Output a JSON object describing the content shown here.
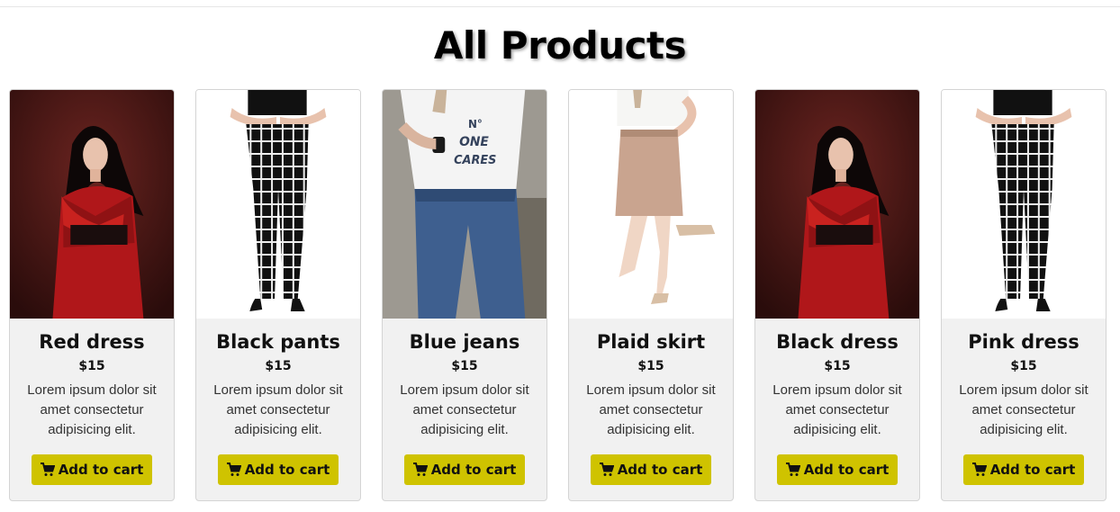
{
  "page": {
    "title": "All Products"
  },
  "theme": {
    "button_color": "#cfc300",
    "card_bg": "#f1f1f1"
  },
  "products": [
    {
      "title": "Red dress",
      "price": "$15",
      "description": "Lorem ipsum dolor sit amet consectetur adipisicing elit.",
      "button": "Add to cart",
      "image": "woman-red-coat",
      "icon": "cart-icon"
    },
    {
      "title": "Black pants",
      "price": "$15",
      "description": "Lorem ipsum dolor sit amet consectetur adipisicing elit.",
      "button": "Add to cart",
      "image": "plaid-black-pants",
      "icon": "cart-icon"
    },
    {
      "title": "Blue jeans",
      "price": "$15",
      "description": "Lorem ipsum dolor sit amet consectetur adipisicing elit.",
      "button": "Add to cart",
      "image": "woman-blue-jeans",
      "icon": "cart-icon"
    },
    {
      "title": "Plaid skirt",
      "price": "$15",
      "description": "Lorem ipsum dolor sit amet consectetur adipisicing elit.",
      "button": "Add to cart",
      "image": "beige-pencil-skirt",
      "icon": "cart-icon"
    },
    {
      "title": "Black dress",
      "price": "$15",
      "description": "Lorem ipsum dolor sit amet consectetur adipisicing elit.",
      "button": "Add to cart",
      "image": "woman-red-coat",
      "icon": "cart-icon"
    },
    {
      "title": "Pink dress",
      "price": "$15",
      "description": "Lorem ipsum dolor sit amet consectetur adipisicing elit.",
      "button": "Add to cart",
      "image": "plaid-black-pants",
      "icon": "cart-icon"
    }
  ]
}
